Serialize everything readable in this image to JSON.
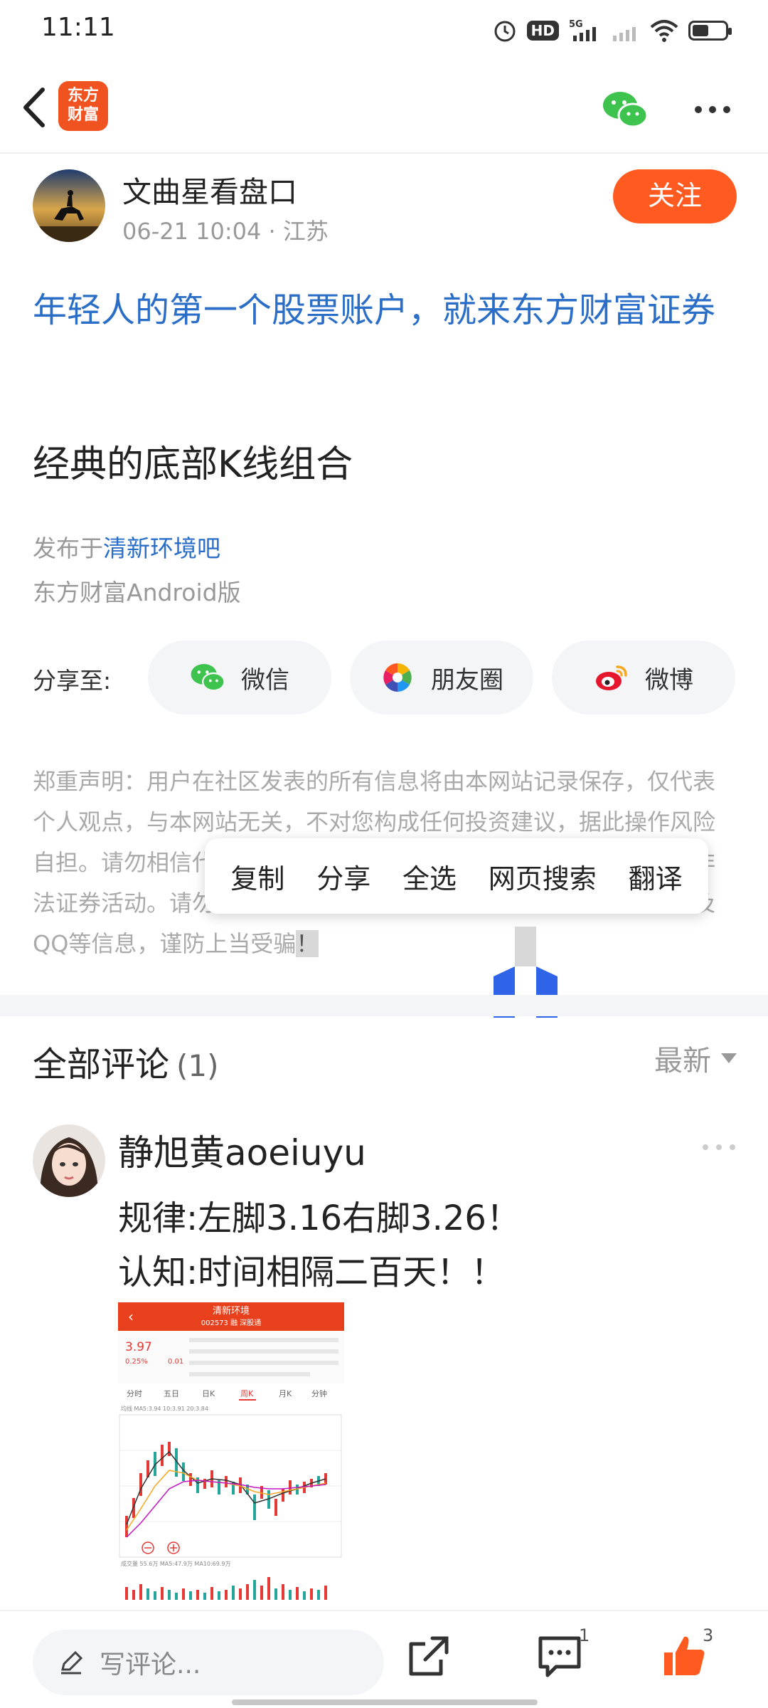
{
  "status_bar": {
    "time": "11:11",
    "hd_label": "HD",
    "network": "5G"
  },
  "nav": {
    "logo_text_line1": "东方",
    "logo_text_line2": "财富",
    "brand_color": "#f0531f"
  },
  "author": {
    "name": "文曲星看盘口",
    "date": "06-21 10:04",
    "location": "江苏",
    "follow_label": "关注"
  },
  "ad_link": "年轻人的第一个股票账户，就来东方财富证券",
  "post": {
    "title": "经典的底部K线组合",
    "posted_in_prefix": "发布于",
    "bar_name": "清新环境吧",
    "client": "东方财富Android版"
  },
  "share": {
    "label": "分享至:",
    "items": [
      {
        "label": "微信",
        "icon": "wechat-icon"
      },
      {
        "label": "朋友圈",
        "icon": "moments-icon"
      },
      {
        "label": "微博",
        "icon": "weibo-icon"
      }
    ]
  },
  "disclaimer": {
    "text_main": "郑重声明：用户在社区发表的所有信息将由本网站记录保存，仅代表个人观点，与本网站无关，不对您构成任何投资建议，据此操作风险自担。请勿相信代客理财、免费荐股和炒股培训等宣传内容，远离非法证券活动。请勿添加发言用户的手机号码、公众号、微博、微信及QQ等信息，谨防上当受骗",
    "text_selected": "！"
  },
  "context_menu": {
    "items": [
      "复制",
      "分享",
      "全选",
      "网页搜索",
      "翻译"
    ]
  },
  "comments": {
    "title": "全部评论",
    "count": "(1)",
    "sort_label": "最新",
    "items": [
      {
        "user": "静旭黄aoeiuyu",
        "line1": "规律:左脚3.16右脚3.26！",
        "line2": "认知:时间相隔二百天！！"
      }
    ]
  },
  "stock_image": {
    "name": "清新环境",
    "code": "002573 融 深股通",
    "price": "3.97",
    "change_pct": "0.25%",
    "change": "0.01",
    "tabs": [
      "分时",
      "五日",
      "日K",
      "周K",
      "月K",
      "分钟"
    ],
    "active_tab": "周K",
    "ma_label": "均线 MA5:3.94 10:3.91 20:3.84",
    "vol_label": "成交量 55.6万 MA5:47.9万 MA10:69.9万"
  },
  "bottom_bar": {
    "input_placeholder": "写评论...",
    "comment_count": "1",
    "like_count": "3",
    "accent": "#ff5a1f"
  }
}
